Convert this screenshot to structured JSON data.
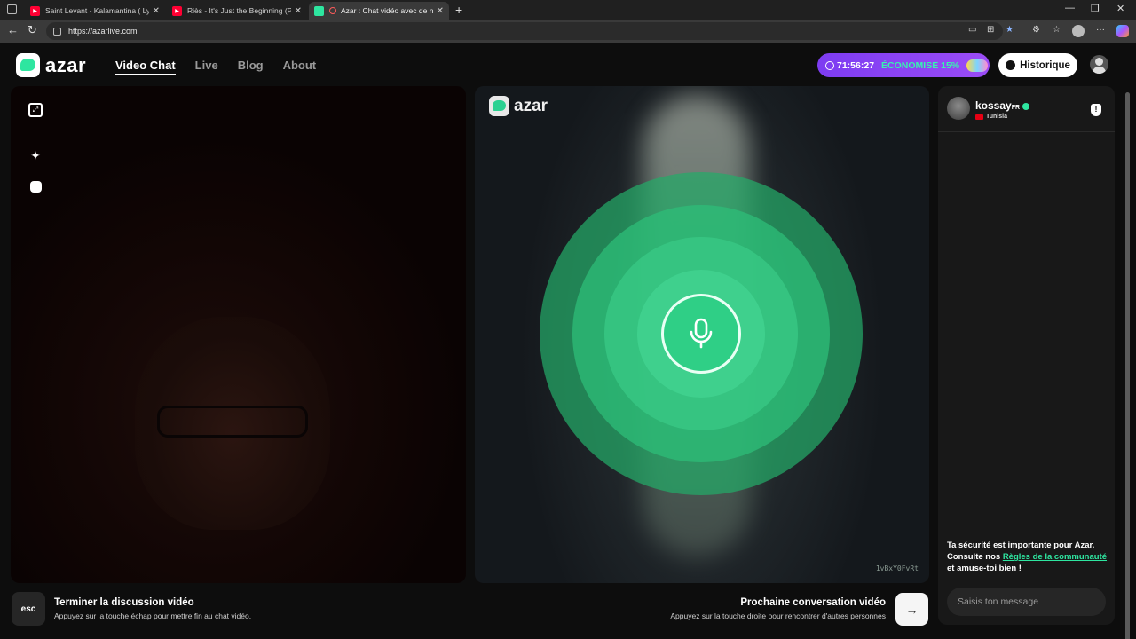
{
  "browser": {
    "tabs": [
      {
        "title": "Saint Levant - Kalamantina ( Lyric",
        "favicon": "youtube-icon"
      },
      {
        "title": "Riès - It's Just the Beginning (Pro",
        "favicon": "youtube-icon"
      },
      {
        "title": "Azar : Chat vidéo avec de no",
        "favicon": "azar-icon",
        "active": true
      }
    ],
    "url": "https://azarlive.com"
  },
  "header": {
    "logo_text": "azar",
    "nav": [
      {
        "label": "Video Chat",
        "active": true
      },
      {
        "label": "Live"
      },
      {
        "label": "Blog"
      },
      {
        "label": "About"
      }
    ],
    "promo": {
      "timer": "71:56:27",
      "discount": "ÉCONOMISE 15%"
    },
    "history_label": "Historique"
  },
  "video": {
    "watermark": "azar",
    "id_text": "1vBxY0FvRt"
  },
  "chat": {
    "username": "kossay",
    "country_code": "FR",
    "country": "Tunisia",
    "notice_pre": "Ta sécurité est importante pour Azar. Consulte nos ",
    "notice_link": "Règles de la communauté",
    "notice_post": " et amuse-toi bien !",
    "input_placeholder": "Saisis ton message"
  },
  "controls": {
    "esc_label": "esc",
    "end_title": "Terminer la discussion vidéo",
    "end_sub": "Appuyez sur la touche échap pour mettre fin au chat vidéo.",
    "next_title": "Prochaine conversation vidéo",
    "next_sub": "Appuyez sur la touche droite pour rencontrer d'autres personnes"
  },
  "colors": {
    "accent": "#2ee6a0",
    "promo_purple": "#8b44f4",
    "background": "#0d0d0d"
  }
}
